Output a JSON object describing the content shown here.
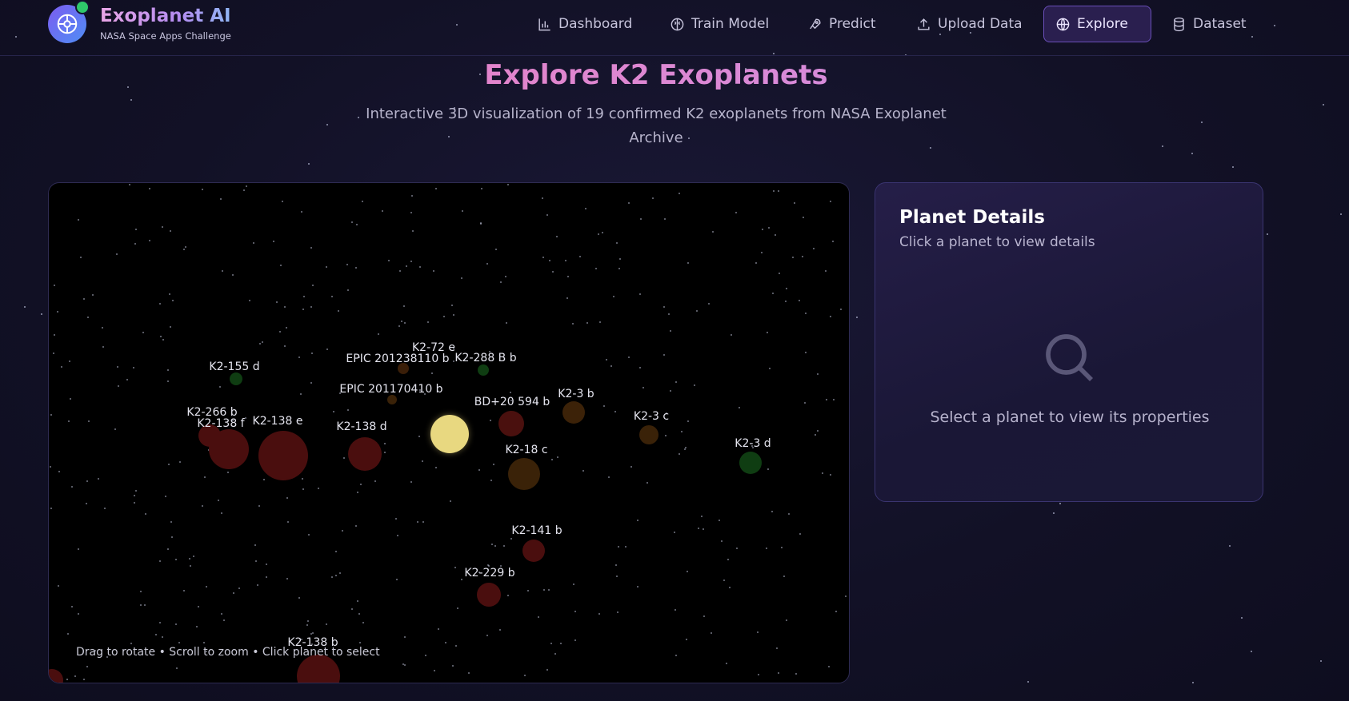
{
  "brand": {
    "title": "Exoplanet AI",
    "subtitle": "NASA Space Apps Challenge"
  },
  "nav": [
    {
      "label": "Dashboard",
      "icon": "bar-chart-icon"
    },
    {
      "label": "Train Model",
      "icon": "brain-icon"
    },
    {
      "label": "Predict",
      "icon": "rocket-icon"
    },
    {
      "label": "Upload Data",
      "icon": "upload-icon"
    },
    {
      "label": "Explore",
      "icon": "globe-icon",
      "active": true
    },
    {
      "label": "Dataset",
      "icon": "database-icon"
    }
  ],
  "page": {
    "title": "Explore K2 Exoplanets",
    "subtitle": "Interactive 3D visualization of 19 confirmed K2 exoplanets from NASA Exoplanet Archive"
  },
  "viz": {
    "hint": "Drag to rotate • Scroll to zoom • Click planet to select",
    "planets": [
      {
        "name": "K2-72 e"
      },
      {
        "name": "EPIC 201238110 b"
      },
      {
        "name": "K2-288 B b"
      },
      {
        "name": "K2-155 d"
      },
      {
        "name": "EPIC 201170410 b"
      },
      {
        "name": "BD+20 594 b"
      },
      {
        "name": "K2-3 b"
      },
      {
        "name": "K2-266 b"
      },
      {
        "name": "K2-138 f"
      },
      {
        "name": "K2-138 e"
      },
      {
        "name": "K2-138 d"
      },
      {
        "name": "K2-3 c"
      },
      {
        "name": "K2-18 c"
      },
      {
        "name": "K2-3 d"
      },
      {
        "name": "K2-141 b"
      },
      {
        "name": "K2-229 b"
      },
      {
        "name": "K2-138 b"
      }
    ]
  },
  "details": {
    "title": "Planet Details",
    "subtitle": "Click a planet to view details",
    "empty": "Select a planet to view its properties"
  },
  "colors": {
    "accent": "#6a4fb8",
    "sun": "#e8d880",
    "panel": "#1f1a3e"
  }
}
